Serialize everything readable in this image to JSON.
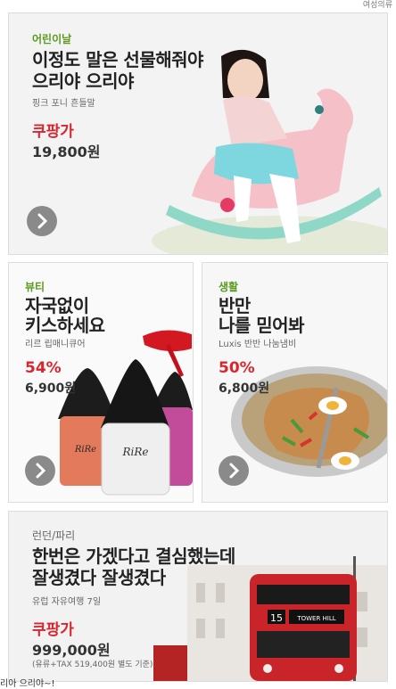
{
  "header": {
    "link": "여성의류"
  },
  "cards": [
    {
      "category": "어린이날",
      "title_line1": "이정도 말은 선물해줘야",
      "title_line2": "으리야 으리야",
      "subtitle": "핑크 포니 흔들말",
      "price_label": "쿠팡가",
      "price": "19,800원"
    },
    {
      "category": "뷰티",
      "title_line1": "자국없이",
      "title_line2": "키스하세요",
      "subtitle": "리르 립매니큐어",
      "discount": "54%",
      "price": "6,900원",
      "brand_text": "RiRe"
    },
    {
      "category": "생활",
      "title_line1": "반만",
      "title_line2": "나를 믿어봐",
      "subtitle": "Luxis 반반 나눔냄비",
      "discount": "50%",
      "price": "6,800원"
    },
    {
      "category": "런던/파리",
      "title_line1": "한번은 가겠다고 결심했는데",
      "title_line2": "잘생겼다 잘생겼다",
      "subtitle": "유럽 자유여행 7일",
      "price_label": "쿠팡가",
      "price": "999,000원",
      "note": "(유류+TAX 519,400원 별도 기준)",
      "bus_number": "15",
      "bus_sign": "TOWER HILL"
    }
  ],
  "footer": {
    "caption": "리아 으리야~!"
  },
  "colors": {
    "accent_green": "#5a9a1e",
    "accent_red": "#d8262e",
    "button_gray": "#8a8a8a"
  },
  "icons": {
    "next": "chevron-right-icon"
  }
}
